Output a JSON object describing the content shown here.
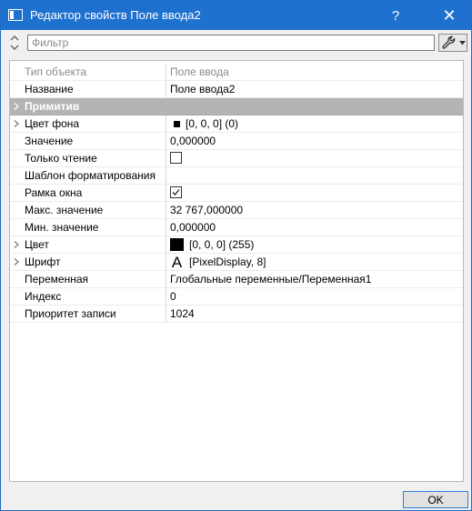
{
  "window": {
    "title": "Редактор свойств Поле ввода2",
    "help_glyph": "?",
    "close_glyph": "✕"
  },
  "filter": {
    "placeholder": "Фильтр",
    "value": ""
  },
  "grid": {
    "header": {
      "name": "Тип объекта",
      "value": "Поле ввода"
    },
    "rows": [
      {
        "name": "Название",
        "value": "Поле ввода2"
      },
      {
        "name": "Примитив",
        "value": ""
      },
      {
        "name": "Цвет фона",
        "value": "[0, 0, 0] (0)"
      },
      {
        "name": "Значение",
        "value": "0,000000"
      },
      {
        "name": "Только чтение",
        "value": "",
        "checked": false
      },
      {
        "name": "Шаблон форматирования",
        "value": ""
      },
      {
        "name": "Рамка окна",
        "value": "",
        "checked": true
      },
      {
        "name": "Макс. значение",
        "value": "32 767,000000"
      },
      {
        "name": "Мин. значение",
        "value": "0,000000"
      },
      {
        "name": "Цвет",
        "value": "[0, 0, 0] (255)"
      },
      {
        "name": "Шрифт",
        "value": "[PixelDisplay, 8]",
        "glyph": "A"
      },
      {
        "name": "Переменная",
        "value": "Глобальные переменные/Переменная1"
      },
      {
        "name": "Индекс",
        "value": "0"
      },
      {
        "name": "Приоритет записи",
        "value": "1024"
      }
    ]
  },
  "footer": {
    "ok_label": "OK"
  },
  "colors": {
    "titlebar": "#1f71cf",
    "category": "#b4b4b4",
    "swatch": "#000000"
  }
}
